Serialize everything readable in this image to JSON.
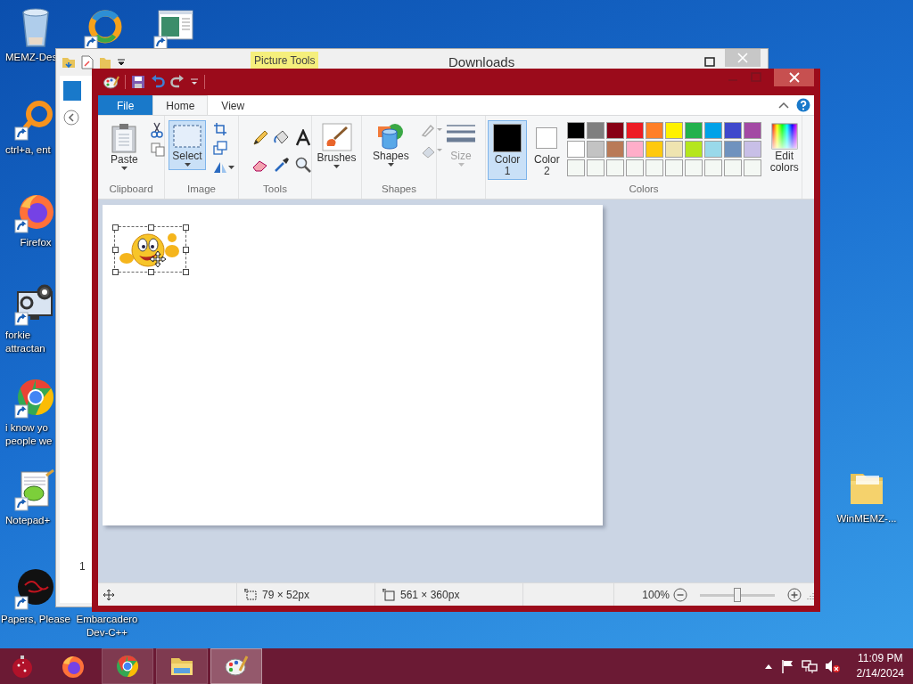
{
  "desktop_icons": [
    {
      "kind": "recycle-bin",
      "shortcut": false,
      "lines": [
        "MEMZ-Des"
      ]
    },
    {
      "kind": "swirl",
      "shortcut": true
    },
    {
      "kind": "window",
      "shortcut": true
    },
    {
      "kind": "ring",
      "shortcut": true,
      "lines": [
        "ctrl+a, ent"
      ]
    },
    {
      "kind": "firefox",
      "shortcut": true,
      "lines": [
        "Firefox"
      ]
    },
    {
      "kind": "gears-monitor",
      "shortcut": true,
      "lines": [
        "forkie",
        "attractan"
      ]
    },
    {
      "kind": "chrome",
      "shortcut": true,
      "lines": [
        "i know yo",
        "people we"
      ]
    },
    {
      "kind": "notepad",
      "shortcut": true,
      "lines": [
        "Notepad+"
      ]
    },
    {
      "kind": "dark-circle",
      "shortcut": true,
      "lines": [
        "Papers, Please"
      ]
    },
    {
      "kind": "covered",
      "lines": [
        "Embarcadero",
        "Dev-C++"
      ]
    },
    {
      "kind": "folder",
      "shortcut": false,
      "lines": [
        "WinMEMZ-..."
      ]
    }
  ],
  "explorer": {
    "title": "Downloads",
    "context_tab": "Picture Tools",
    "status_text": "1"
  },
  "paint": {
    "tabs": [
      {
        "label": "File",
        "kind": "file",
        "selected": false
      },
      {
        "label": "Home",
        "kind": "tab",
        "selected": true
      },
      {
        "label": "View",
        "kind": "tab",
        "selected": false
      }
    ],
    "clipboard": {
      "label": "Clipboard",
      "paste": "Paste"
    },
    "image": {
      "label": "Image",
      "select": {
        "label": "Select",
        "selected": true
      }
    },
    "tools": {
      "label": "Tools"
    },
    "brushes": {
      "label": "Brushes"
    },
    "shapes": {
      "button": "Shapes",
      "label": "Shapes"
    },
    "size": {
      "label": "Size",
      "disabled": true
    },
    "colors": {
      "label": "Colors",
      "color1": {
        "lines": [
          "Color",
          "1"
        ],
        "color": "#000000",
        "selected": true
      },
      "color2": {
        "lines": [
          "Color",
          "2"
        ],
        "color": "#ffffff",
        "selected": false
      },
      "palette": [
        {
          "kind": "swatch",
          "color": "#000000"
        },
        {
          "kind": "swatch",
          "color": "#7f7f7f"
        },
        {
          "kind": "swatch",
          "color": "#880015"
        },
        {
          "kind": "swatch",
          "color": "#ed1c24"
        },
        {
          "kind": "swatch",
          "color": "#ff7f27"
        },
        {
          "kind": "swatch",
          "color": "#fff200"
        },
        {
          "kind": "swatch",
          "color": "#22b14c"
        },
        {
          "kind": "swatch",
          "color": "#00a2e8"
        },
        {
          "kind": "swatch",
          "color": "#3f48cc"
        },
        {
          "kind": "swatch",
          "color": "#a349a4"
        },
        {
          "kind": "swatch",
          "color": "#ffffff"
        },
        {
          "kind": "swatch",
          "color": "#c3c3c3"
        },
        {
          "kind": "swatch",
          "color": "#b97a57"
        },
        {
          "kind": "swatch",
          "color": "#ffaec9"
        },
        {
          "kind": "swatch",
          "color": "#ffc90e"
        },
        {
          "kind": "swatch",
          "color": "#efe4b0"
        },
        {
          "kind": "swatch",
          "color": "#b5e61d"
        },
        {
          "kind": "swatch",
          "color": "#99d9ea"
        },
        {
          "kind": "swatch",
          "color": "#7092be"
        },
        {
          "kind": "swatch",
          "color": "#c8bfe7"
        },
        {
          "kind": "empty"
        },
        {
          "kind": "empty"
        },
        {
          "kind": "empty"
        },
        {
          "kind": "empty"
        },
        {
          "kind": "empty"
        },
        {
          "kind": "empty"
        },
        {
          "kind": "empty"
        },
        {
          "kind": "empty"
        },
        {
          "kind": "empty"
        },
        {
          "kind": "empty"
        }
      ],
      "edit": [
        "Edit",
        "colors"
      ]
    },
    "status": {
      "selection_size": "79 × 52px",
      "canvas_size": "561 × 360px",
      "zoom": "100%",
      "zoom_slider": {
        "level": 0.5
      }
    }
  },
  "taskbar": {
    "apps": [
      {
        "kind": "ornament",
        "running": false,
        "selected": false
      },
      {
        "kind": "firefox",
        "running": false,
        "selected": false
      },
      {
        "kind": "chrome",
        "running": true,
        "selected": false
      },
      {
        "kind": "explorer",
        "running": true,
        "selected": false
      },
      {
        "kind": "paint",
        "running": true,
        "selected": true
      }
    ],
    "time": "11:09 PM",
    "date": "2/14/2024"
  }
}
